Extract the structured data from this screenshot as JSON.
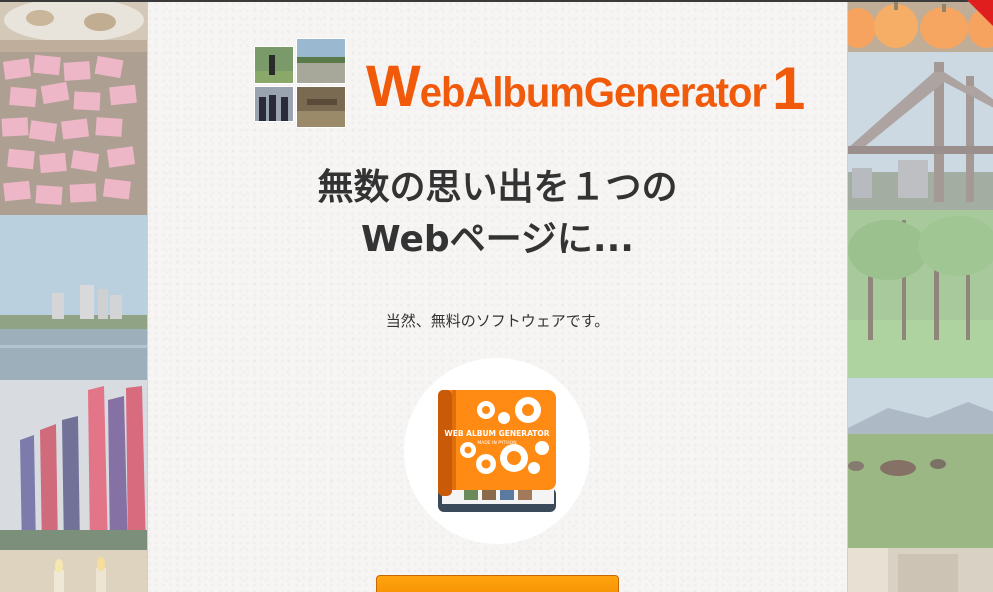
{
  "logo": {
    "initial": "W",
    "rest": "ebAlbumGenerator",
    "version": "1",
    "icon_name": "photo-tiles-icon"
  },
  "headline": {
    "line1": "無数の思い出を１つの",
    "line2": "Webページに..."
  },
  "subtext": "当然、無料のソフトウェアです。",
  "app_icon": {
    "title": "WEB ALBUM GENERATOR",
    "subtitle": "MADE IN PYTHON",
    "icon_name": "gears-book-icon"
  },
  "download_button": {
    "label": ""
  },
  "colors": {
    "brand_orange": "#f05a0a",
    "button_orange": "#f7940a",
    "headline": "#333333",
    "corner_tag": "#e01e1e"
  }
}
